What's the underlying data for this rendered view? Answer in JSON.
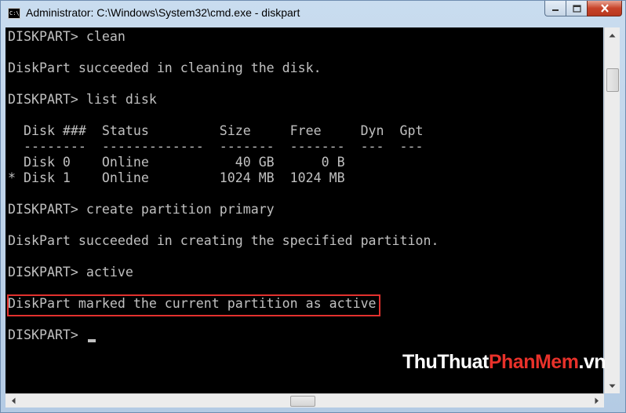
{
  "window": {
    "title": "Administrator: C:\\Windows\\System32\\cmd.exe - diskpart",
    "icon": "cmd-app-icon",
    "icon_text": "C:\\",
    "buttons": {
      "minimize": "minimize-icon",
      "maximize": "maximize-icon",
      "close": "close-icon"
    }
  },
  "console": {
    "lines": [
      "DISKPART> clean",
      "",
      "DiskPart succeeded in cleaning the disk.",
      "",
      "DISKPART> list disk",
      "",
      "  Disk ###  Status         Size     Free     Dyn  Gpt",
      "  --------  -------------  -------  -------  ---  ---",
      "  Disk 0    Online           40 GB      0 B",
      "* Disk 1    Online         1024 MB  1024 MB",
      "",
      "DISKPART> create partition primary",
      "",
      "DiskPart succeeded in creating the specified partition.",
      "",
      "DISKPART> active",
      "",
      "DiskPart marked the current partition as active",
      "",
      "DISKPART> "
    ],
    "highlighted_line_index": 17,
    "text_color": "#c0c0c0",
    "background_color": "#000000"
  },
  "annotation": {
    "highlight_color": "#e2312e"
  },
  "watermark": {
    "part1": "ThuThuat",
    "part2": "PhanMem",
    "part3": ".vn"
  }
}
